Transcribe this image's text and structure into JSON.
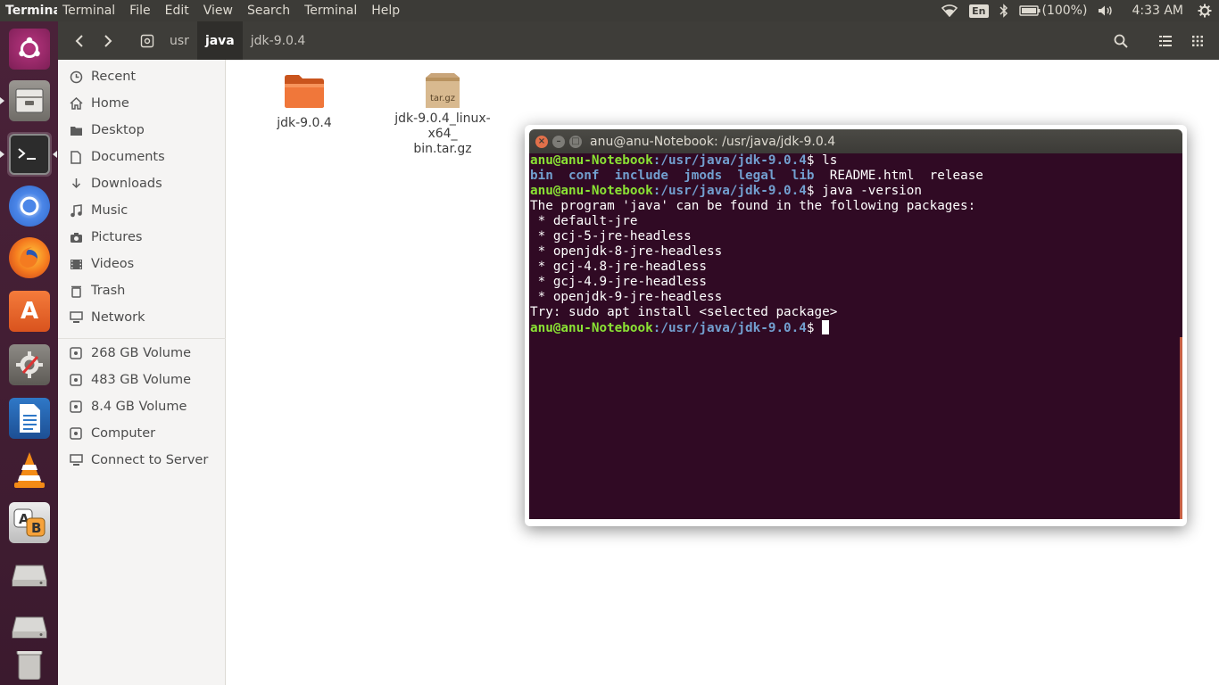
{
  "top_panel": {
    "app_title": "Terminal",
    "menu": [
      "Terminal",
      "File",
      "Edit",
      "View",
      "Search",
      "Terminal",
      "Help"
    ],
    "language": "En",
    "battery": "(100%)",
    "clock": "4:33 AM"
  },
  "launcher": {
    "items": [
      "dash-home",
      "files",
      "terminal",
      "chromium",
      "firefox",
      "ubuntu-software",
      "system-settings",
      "libreoffice-writer",
      "vlc",
      "language-support",
      "drive-1",
      "drive-2",
      "trash"
    ]
  },
  "file_manager": {
    "breadcrumb": [
      "usr",
      "java",
      "jdk-9.0.4"
    ],
    "active_crumb": "java",
    "sidebar": {
      "places": [
        "Recent",
        "Home",
        "Desktop",
        "Documents",
        "Downloads",
        "Music",
        "Pictures",
        "Videos",
        "Trash",
        "Network"
      ],
      "devices": [
        "268 GB Volume",
        "483 GB Volume",
        "8.4 GB Volume",
        "Computer",
        "Connect to Server"
      ]
    },
    "files": [
      {
        "name": "jdk-9.0.4",
        "type": "folder"
      },
      {
        "name": "jdk-9.0.4_linux-x64_bin.tar.gz",
        "name_line1": "jdk-9.0.4_linux-x64_",
        "name_line2": "bin.tar.gz",
        "type": "archive",
        "badge": "tar.gz"
      }
    ]
  },
  "terminal": {
    "title": "anu@anu-Notebook: /usr/java/jdk-9.0.4",
    "prompt_user": "anu@anu-Notebook",
    "prompt_path": ":/usr/java/jdk-9.0.4",
    "prompt_sign": "$ ",
    "cmd1": "ls",
    "ls_dirs": [
      "bin",
      "conf",
      "include",
      "jmods",
      "legal",
      "lib"
    ],
    "ls_files": "README.html  release",
    "cmd2": "java -version",
    "output": [
      "The program 'java' can be found in the following packages:",
      " * default-jre",
      " * gcj-5-jre-headless",
      " * openjdk-8-jre-headless",
      " * gcj-4.8-jre-headless",
      " * gcj-4.9-jre-headless",
      " * openjdk-9-jre-headless",
      "Try: sudo apt install <selected package>"
    ]
  },
  "colors": {
    "terminal_bg": "#300a24",
    "prompt_user": "#8ae234",
    "prompt_path": "#729fcf",
    "accent": "#e2704a",
    "launcher_bg": "#3b1a2e"
  }
}
